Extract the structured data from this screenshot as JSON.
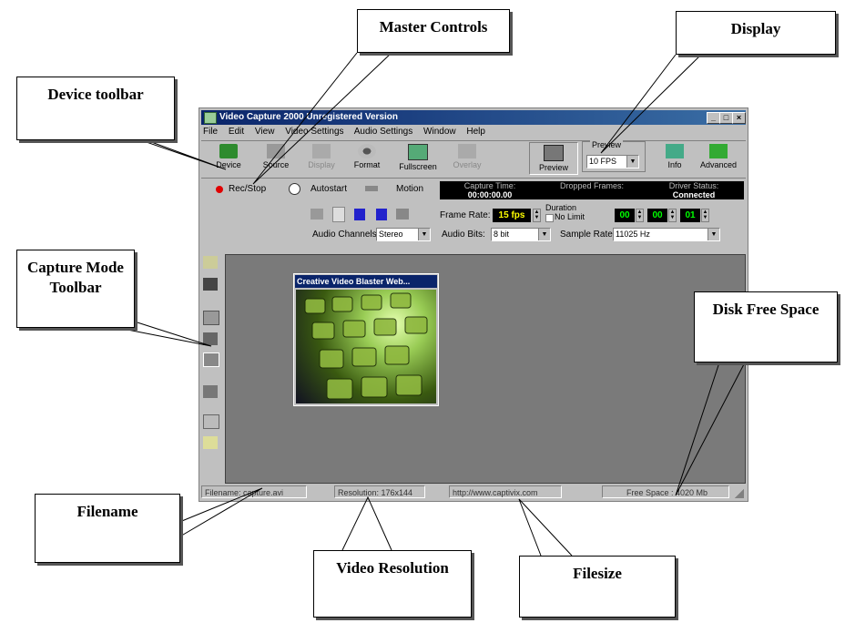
{
  "callouts": {
    "master_controls": "Master Controls",
    "display": "Display",
    "device_toolbar": "Device toolbar",
    "capture_mode_line1": "Capture Mode",
    "capture_mode_line2": "Toolbar",
    "disk_free_space": "Disk Free Space",
    "filename": "Filename",
    "video_resolution": "Video Resolution",
    "filesize": "Filesize"
  },
  "window": {
    "title": "Video Capture 2000 Unregistered Version",
    "menu": [
      "File",
      "Edit",
      "View",
      "Video Settings",
      "Audio Settings",
      "Window",
      "Help"
    ],
    "toolbar": {
      "device": "Device",
      "source": "Source",
      "display": "Display",
      "format": "Format",
      "fullscreen": "Fullscreen",
      "overlay": "Overlay",
      "preview": "Preview",
      "preview_group": "Preview",
      "fps": "10 FPS",
      "info": "Info",
      "advanced": "Advanced"
    },
    "master": {
      "rec_stop": "Rec/Stop",
      "autostart": "Autostart",
      "motion": "Motion",
      "capture_time_label": "Capture Time:",
      "capture_time_value": "00:00:00.00",
      "dropped_frames_label": "Dropped Frames:",
      "dropped_frames_value": "",
      "driver_status_label": "Driver Status:",
      "driver_status_value": "Connected"
    },
    "settings": {
      "frame_rate_label": "Frame Rate:",
      "frame_rate_value": "15 fps",
      "duration_label": "Duration",
      "no_limit_label": "No Limit",
      "dur_h": "00",
      "dur_m": "00",
      "dur_s": "01",
      "audio_channels_label": "Audio Channels:",
      "audio_channels_value": "Stereo",
      "audio_bits_label": "Audio Bits:",
      "audio_bits_value": "8 bit",
      "sample_rate_label": "Sample Rate:",
      "sample_rate_value": "11025 Hz"
    },
    "preview_window_title": "Creative Video Blaster Web...",
    "status": {
      "filename": "Filename: capture.avi",
      "resolution": "Resolution: 176x144",
      "url": "http://www.captivix.com",
      "free_space": "Free Space : 4020 Mb"
    }
  },
  "colors": {
    "title_bar": "#0a246a",
    "workspace": "#7a7a7a",
    "lcd_text": "#00ff00",
    "rec_dot": "#e00000"
  }
}
